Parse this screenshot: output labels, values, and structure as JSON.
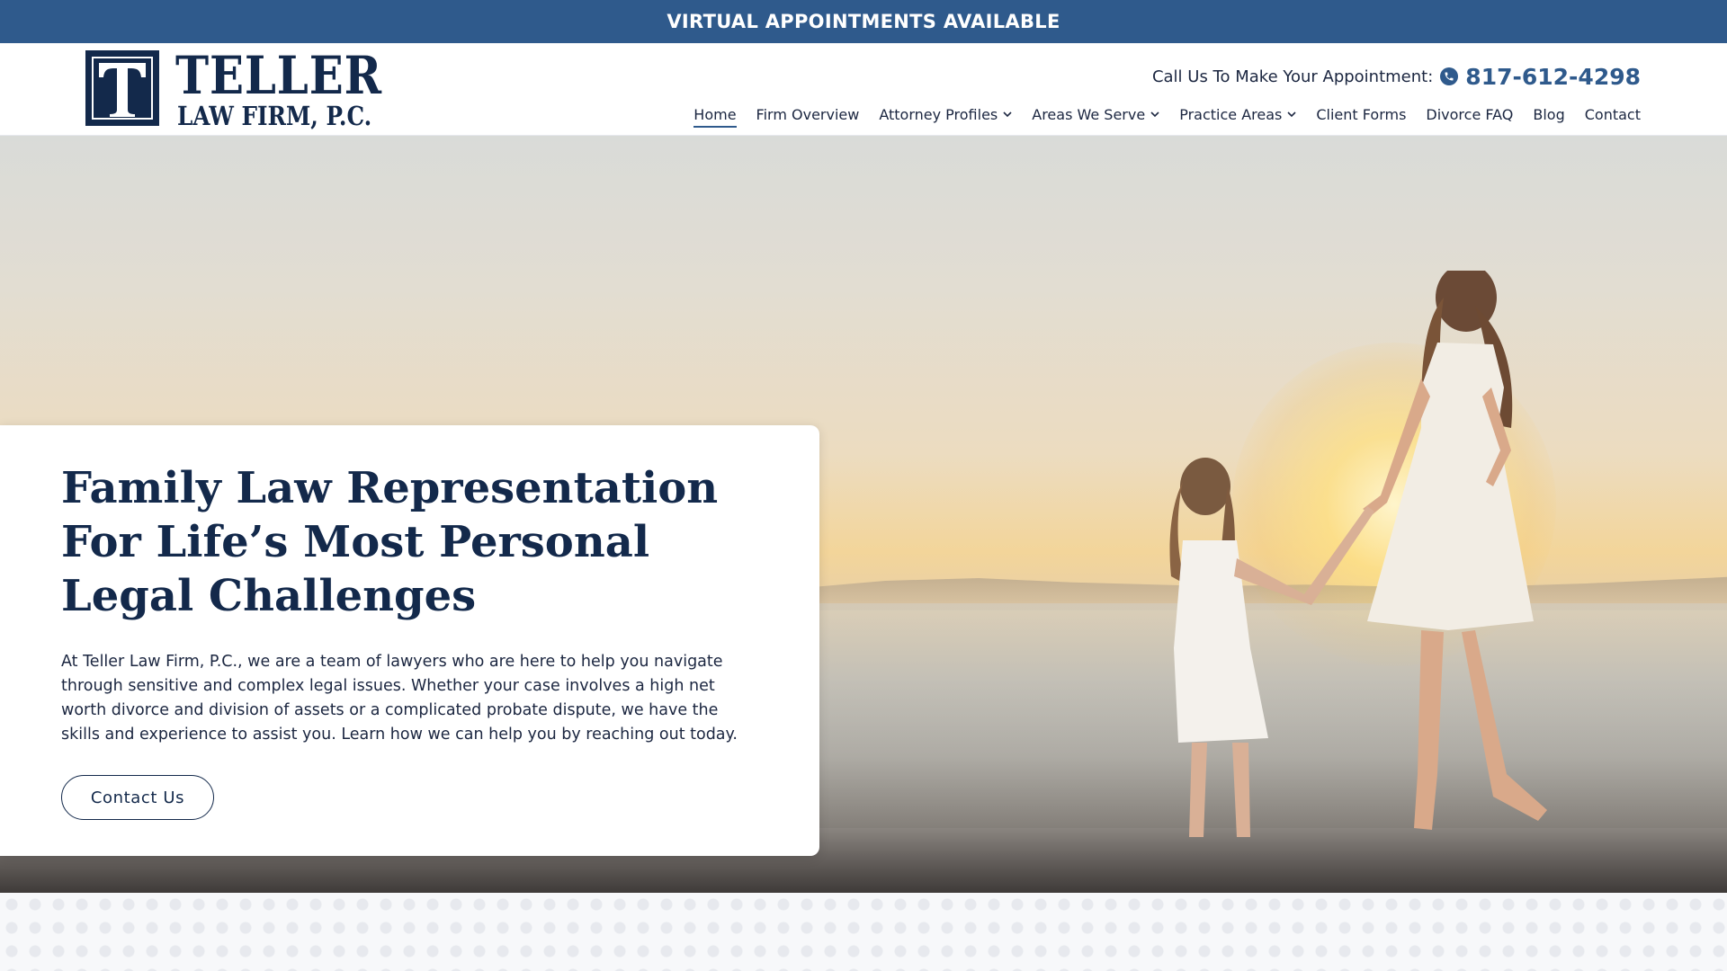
{
  "announcement": {
    "text": "VIRTUAL APPOINTMENTS AVAILABLE"
  },
  "logo": {
    "mark": "T",
    "title": "TELLER",
    "subtitle": "LAW FIRM, P.C."
  },
  "header": {
    "call_label": "Call Us To Make Your Appointment:",
    "phone": "817-612-4298",
    "phone_icon": "phone-icon"
  },
  "nav": {
    "items": [
      {
        "label": "Home",
        "active": true,
        "dropdown": false
      },
      {
        "label": "Firm Overview",
        "active": false,
        "dropdown": false
      },
      {
        "label": "Attorney Profiles",
        "active": false,
        "dropdown": true
      },
      {
        "label": "Areas We Serve",
        "active": false,
        "dropdown": true
      },
      {
        "label": "Practice Areas",
        "active": false,
        "dropdown": true
      },
      {
        "label": "Client Forms",
        "active": false,
        "dropdown": false
      },
      {
        "label": "Divorce FAQ",
        "active": false,
        "dropdown": false
      },
      {
        "label": "Blog",
        "active": false,
        "dropdown": false
      },
      {
        "label": "Contact",
        "active": false,
        "dropdown": false
      }
    ],
    "chevron": "⌄"
  },
  "hero": {
    "title": "Family Law Representation For Life’s Most Personal Legal Challenges",
    "body": "At Teller Law Firm, P.C., we are a team of lawyers who are here to help you navigate through sensitive and complex legal issues. Whether your case involves a high net worth divorce and division of assets or a complicated probate dispute, we have the skills and experience to assist you. Learn how we can help you by reaching out today.",
    "cta_label": "Contact Us"
  },
  "colors": {
    "brand_navy": "#13294b",
    "brand_blue": "#2f5a8c",
    "text": "#1b2640"
  }
}
